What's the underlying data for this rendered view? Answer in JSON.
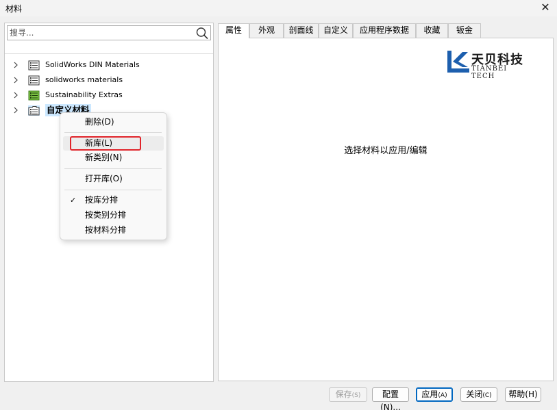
{
  "window": {
    "title": "材料",
    "close_glyph": "✕"
  },
  "search": {
    "placeholder": "搜寻..."
  },
  "tree": {
    "items": [
      {
        "label": "SolidWorks DIN Materials",
        "icon": "library-icon"
      },
      {
        "label": "solidworks materials",
        "icon": "library-icon"
      },
      {
        "label": "Sustainability Extras",
        "icon": "library-green-icon"
      },
      {
        "label": "自定义材料",
        "icon": "library-folder-icon",
        "selected": true
      }
    ]
  },
  "context_menu": {
    "items": [
      {
        "label": "删除(D)"
      },
      {
        "label": "新库(L)",
        "highlighted": true
      },
      {
        "label": "新类别(N)"
      },
      {
        "label": "打开库(O)"
      },
      {
        "label": "按库分排",
        "checked": true
      },
      {
        "label": "按类别分排"
      },
      {
        "label": "按材料分排"
      }
    ]
  },
  "tabs": [
    "属性",
    "外观",
    "剖面线",
    "自定义",
    "应用程序数据",
    "收藏",
    "钣金"
  ],
  "active_tab": "属性",
  "logo": {
    "main": "天贝科技",
    "sub": "TIANBEI TECH",
    "color": "#1d5fae"
  },
  "main": {
    "message": "选择材料以应用/编辑"
  },
  "buttons": {
    "save": "保存",
    "save_key": "(S)",
    "config": "配置(N)...",
    "apply": "应用",
    "apply_key": "(A)",
    "close": "关闭",
    "close_key": "(C)",
    "help": "帮助(H)"
  }
}
